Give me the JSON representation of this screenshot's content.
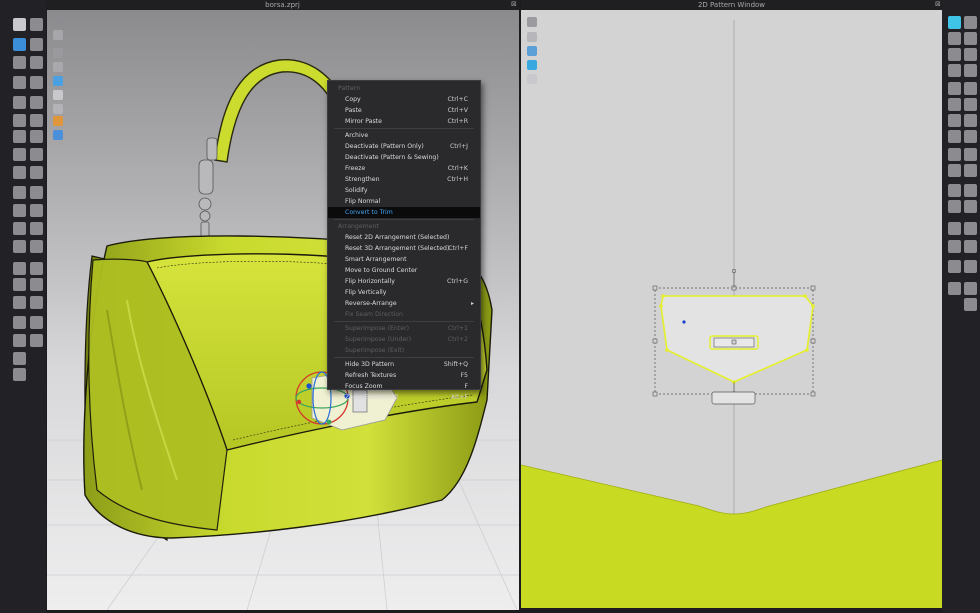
{
  "window": {
    "title_3d": "borsa.zprj",
    "title_2d": "2D Pattern Window",
    "close_glyph": "⊠"
  },
  "context_menu": {
    "sections": [
      {
        "header": "Pattern",
        "items": [
          {
            "label": "Copy",
            "shortcut": "Ctrl+C"
          },
          {
            "label": "Paste",
            "shortcut": "Ctrl+V"
          },
          {
            "label": "Mirror Paste",
            "shortcut": "Ctrl+R"
          }
        ]
      },
      {
        "header": "",
        "items": [
          {
            "label": "Archive",
            "shortcut": ""
          },
          {
            "label": "Deactivate (Pattern Only)",
            "shortcut": "Ctrl+J"
          },
          {
            "label": "Deactivate (Pattern & Sewing)",
            "shortcut": ""
          },
          {
            "label": "Freeze",
            "shortcut": "Ctrl+K"
          },
          {
            "label": "Strengthen",
            "shortcut": "Ctrl+H"
          },
          {
            "label": "Solidify",
            "shortcut": ""
          },
          {
            "label": "Flip Normal",
            "shortcut": ""
          },
          {
            "label": "Convert to Trim",
            "shortcut": "",
            "highlighted": true
          }
        ]
      },
      {
        "header": "Arrangement",
        "items": [
          {
            "label": "Reset 2D Arrangement (Selected)",
            "shortcut": ""
          },
          {
            "label": "Reset 3D Arrangement (Selected)",
            "shortcut": "Ctrl+F"
          },
          {
            "label": "Smart Arrangement",
            "shortcut": ""
          },
          {
            "label": "Move to Ground Center",
            "shortcut": ""
          },
          {
            "label": "Flip Horizontally",
            "shortcut": "Ctrl+G"
          },
          {
            "label": "Flip Vertically",
            "shortcut": ""
          },
          {
            "label": "Reverse-Arrange",
            "shortcut": "",
            "submenu": true
          },
          {
            "label": "Fix Seam Direction",
            "shortcut": "",
            "disabled": true
          }
        ]
      },
      {
        "header": "",
        "items": [
          {
            "label": "Superimpose (Enter)",
            "shortcut": "Ctrl+1",
            "disabled": true
          },
          {
            "label": "Superimpose (Under)",
            "shortcut": "Ctrl+2",
            "disabled": true
          },
          {
            "label": "Superimpose (Exit)",
            "shortcut": "",
            "disabled": true
          }
        ]
      },
      {
        "header": "",
        "items": [
          {
            "label": "Hide 3D Pattern",
            "shortcut": "Shift+Q"
          },
          {
            "label": "Refresh Textures",
            "shortcut": "F5"
          },
          {
            "label": "Focus Zoom",
            "shortcut": "F"
          },
          {
            "label": "Zoom Extents All",
            "shortcut": "Alt+F"
          }
        ]
      }
    ]
  },
  "colors": {
    "fabric": "#c8d82c",
    "fabric_shadow": "#7d8a14",
    "highlight_blue": "#43a6f5",
    "pattern_bg": "#d3d3d3"
  },
  "icons": {
    "left_toolbar": [
      "select-mesh-icon",
      "transform-pattern-icon",
      "gizmo-icon",
      "fold-arrangement-icon",
      "tack-icon",
      "pin-icon",
      "measure-icon",
      "trim-icon",
      "button-icon",
      "zipper-icon",
      "topstitch-icon",
      "avatar-icon"
    ],
    "right_toolbar": [
      "edit-pattern-icon",
      "transform-icon",
      "point-icon",
      "segment-icon",
      "rectangle-icon",
      "polygon-icon",
      "dart-icon",
      "sewing-icon",
      "text-icon",
      "grading-icon"
    ]
  }
}
